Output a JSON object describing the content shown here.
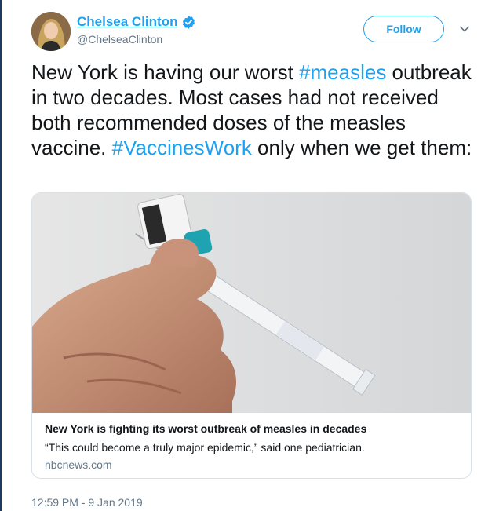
{
  "author": {
    "name": "Chelsea Clinton",
    "handle": "@ChelseaClinton"
  },
  "actions": {
    "follow_label": "Follow"
  },
  "tweet": {
    "part1": "New York is having our worst ",
    "hashtag1": "#measles",
    "part2": " outbreak in two decades. Most cases had not received both recommended doses of the measles vaccine. ",
    "hashtag2": "#VaccinesWork",
    "part3": " only when we get them:"
  },
  "card": {
    "title": "New York is fighting its worst outbreak of measles in decades",
    "description": "“This could become a truly major epidemic,” said one pediatrician.",
    "domain": "nbcnews.com"
  },
  "meta": {
    "timestamp": "12:59 PM - 9 Jan 2019"
  },
  "colors": {
    "link": "#1da1f2",
    "text": "#14171a",
    "secondary": "#657786"
  },
  "icons": {
    "verified": "verified-badge-icon",
    "caret": "chevron-down-icon"
  }
}
